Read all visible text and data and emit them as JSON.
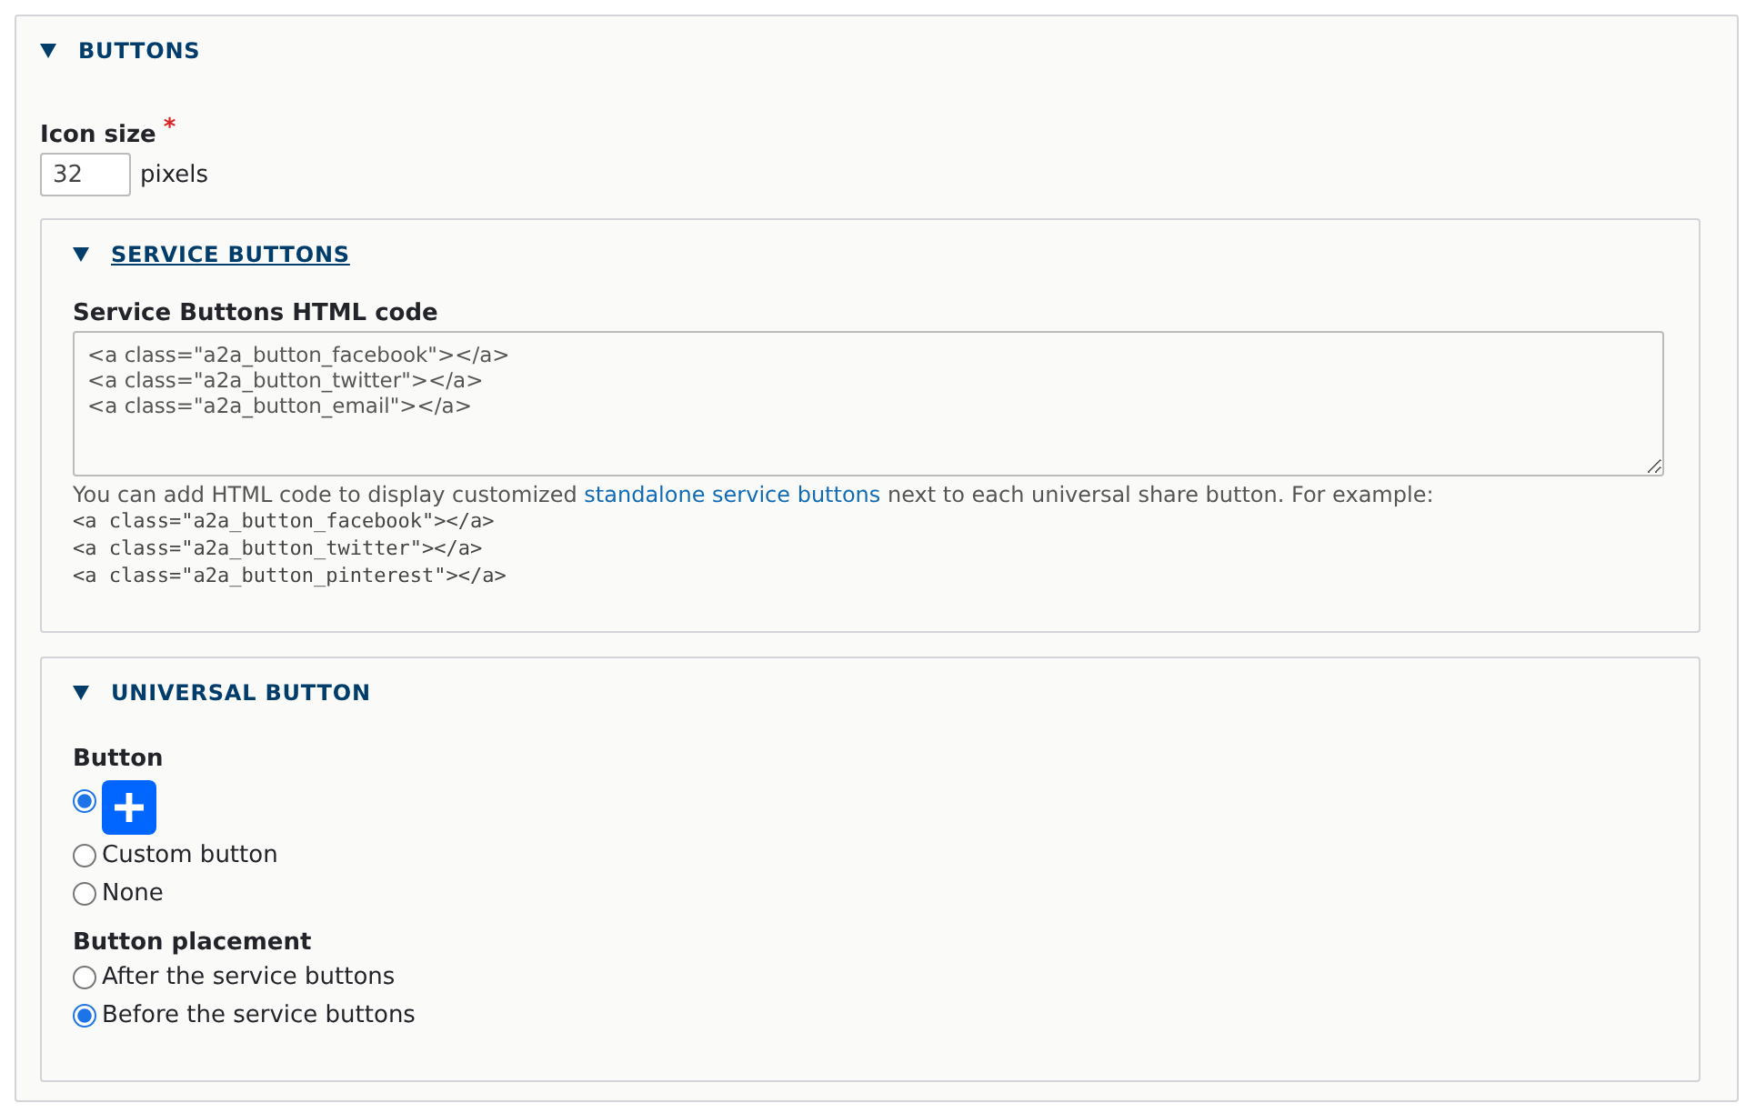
{
  "section": {
    "title": "BUTTONS",
    "expanded": true
  },
  "icon_size": {
    "label": "Icon size",
    "required_mark": "*",
    "value": "32",
    "suffix": "pixels"
  },
  "service_buttons": {
    "title": "SERVICE BUTTONS",
    "expanded": true,
    "field_label": "Service Buttons HTML code",
    "value_lines": [
      "<a class=\"a2a_button_facebook\"></a>",
      "<a class=\"a2a_button_twitter\"></a>",
      "<a class=\"a2a_button_email\"></a>"
    ],
    "description_before": "You can add HTML code to display customized ",
    "description_link": "standalone service buttons",
    "description_after": " next to each universal share button. For example:",
    "example_lines": [
      "<a class=\"a2a_button_facebook\"></a>",
      "<a class=\"a2a_button_twitter\"></a>",
      "<a class=\"a2a_button_pinterest\"></a>"
    ]
  },
  "universal_button": {
    "title": "UNIVERSAL BUTTON",
    "expanded": true,
    "groups": [
      {
        "label": "Button",
        "options": [
          {
            "kind": "icon",
            "selected": true
          },
          {
            "kind": "text",
            "label": "Custom button",
            "selected": false
          },
          {
            "kind": "text",
            "label": "None",
            "selected": false
          }
        ]
      },
      {
        "label": "Button placement",
        "options": [
          {
            "kind": "text",
            "label": "After the service buttons",
            "selected": false
          },
          {
            "kind": "text",
            "label": "Before the service buttons",
            "selected": true
          }
        ]
      }
    ]
  }
}
